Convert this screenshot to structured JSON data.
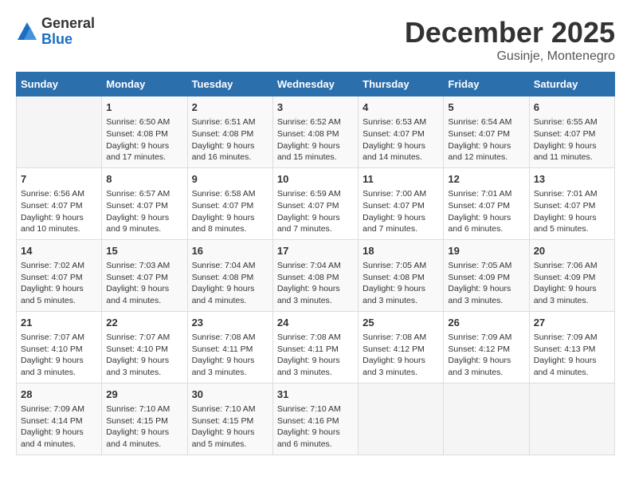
{
  "logo": {
    "general": "General",
    "blue": "Blue"
  },
  "title": "December 2025",
  "location": "Gusinje, Montenegro",
  "weekdays": [
    "Sunday",
    "Monday",
    "Tuesday",
    "Wednesday",
    "Thursday",
    "Friday",
    "Saturday"
  ],
  "weeks": [
    [
      {
        "day": "",
        "info": ""
      },
      {
        "day": "1",
        "info": "Sunrise: 6:50 AM\nSunset: 4:08 PM\nDaylight: 9 hours\nand 17 minutes."
      },
      {
        "day": "2",
        "info": "Sunrise: 6:51 AM\nSunset: 4:08 PM\nDaylight: 9 hours\nand 16 minutes."
      },
      {
        "day": "3",
        "info": "Sunrise: 6:52 AM\nSunset: 4:08 PM\nDaylight: 9 hours\nand 15 minutes."
      },
      {
        "day": "4",
        "info": "Sunrise: 6:53 AM\nSunset: 4:07 PM\nDaylight: 9 hours\nand 14 minutes."
      },
      {
        "day": "5",
        "info": "Sunrise: 6:54 AM\nSunset: 4:07 PM\nDaylight: 9 hours\nand 12 minutes."
      },
      {
        "day": "6",
        "info": "Sunrise: 6:55 AM\nSunset: 4:07 PM\nDaylight: 9 hours\nand 11 minutes."
      }
    ],
    [
      {
        "day": "7",
        "info": "Sunrise: 6:56 AM\nSunset: 4:07 PM\nDaylight: 9 hours\nand 10 minutes."
      },
      {
        "day": "8",
        "info": "Sunrise: 6:57 AM\nSunset: 4:07 PM\nDaylight: 9 hours\nand 9 minutes."
      },
      {
        "day": "9",
        "info": "Sunrise: 6:58 AM\nSunset: 4:07 PM\nDaylight: 9 hours\nand 8 minutes."
      },
      {
        "day": "10",
        "info": "Sunrise: 6:59 AM\nSunset: 4:07 PM\nDaylight: 9 hours\nand 7 minutes."
      },
      {
        "day": "11",
        "info": "Sunrise: 7:00 AM\nSunset: 4:07 PM\nDaylight: 9 hours\nand 7 minutes."
      },
      {
        "day": "12",
        "info": "Sunrise: 7:01 AM\nSunset: 4:07 PM\nDaylight: 9 hours\nand 6 minutes."
      },
      {
        "day": "13",
        "info": "Sunrise: 7:01 AM\nSunset: 4:07 PM\nDaylight: 9 hours\nand 5 minutes."
      }
    ],
    [
      {
        "day": "14",
        "info": "Sunrise: 7:02 AM\nSunset: 4:07 PM\nDaylight: 9 hours\nand 5 minutes."
      },
      {
        "day": "15",
        "info": "Sunrise: 7:03 AM\nSunset: 4:07 PM\nDaylight: 9 hours\nand 4 minutes."
      },
      {
        "day": "16",
        "info": "Sunrise: 7:04 AM\nSunset: 4:08 PM\nDaylight: 9 hours\nand 4 minutes."
      },
      {
        "day": "17",
        "info": "Sunrise: 7:04 AM\nSunset: 4:08 PM\nDaylight: 9 hours\nand 3 minutes."
      },
      {
        "day": "18",
        "info": "Sunrise: 7:05 AM\nSunset: 4:08 PM\nDaylight: 9 hours\nand 3 minutes."
      },
      {
        "day": "19",
        "info": "Sunrise: 7:05 AM\nSunset: 4:09 PM\nDaylight: 9 hours\nand 3 minutes."
      },
      {
        "day": "20",
        "info": "Sunrise: 7:06 AM\nSunset: 4:09 PM\nDaylight: 9 hours\nand 3 minutes."
      }
    ],
    [
      {
        "day": "21",
        "info": "Sunrise: 7:07 AM\nSunset: 4:10 PM\nDaylight: 9 hours\nand 3 minutes."
      },
      {
        "day": "22",
        "info": "Sunrise: 7:07 AM\nSunset: 4:10 PM\nDaylight: 9 hours\nand 3 minutes."
      },
      {
        "day": "23",
        "info": "Sunrise: 7:08 AM\nSunset: 4:11 PM\nDaylight: 9 hours\nand 3 minutes."
      },
      {
        "day": "24",
        "info": "Sunrise: 7:08 AM\nSunset: 4:11 PM\nDaylight: 9 hours\nand 3 minutes."
      },
      {
        "day": "25",
        "info": "Sunrise: 7:08 AM\nSunset: 4:12 PM\nDaylight: 9 hours\nand 3 minutes."
      },
      {
        "day": "26",
        "info": "Sunrise: 7:09 AM\nSunset: 4:12 PM\nDaylight: 9 hours\nand 3 minutes."
      },
      {
        "day": "27",
        "info": "Sunrise: 7:09 AM\nSunset: 4:13 PM\nDaylight: 9 hours\nand 4 minutes."
      }
    ],
    [
      {
        "day": "28",
        "info": "Sunrise: 7:09 AM\nSunset: 4:14 PM\nDaylight: 9 hours\nand 4 minutes."
      },
      {
        "day": "29",
        "info": "Sunrise: 7:10 AM\nSunset: 4:15 PM\nDaylight: 9 hours\nand 4 minutes."
      },
      {
        "day": "30",
        "info": "Sunrise: 7:10 AM\nSunset: 4:15 PM\nDaylight: 9 hours\nand 5 minutes."
      },
      {
        "day": "31",
        "info": "Sunrise: 7:10 AM\nSunset: 4:16 PM\nDaylight: 9 hours\nand 6 minutes."
      },
      {
        "day": "",
        "info": ""
      },
      {
        "day": "",
        "info": ""
      },
      {
        "day": "",
        "info": ""
      }
    ]
  ]
}
